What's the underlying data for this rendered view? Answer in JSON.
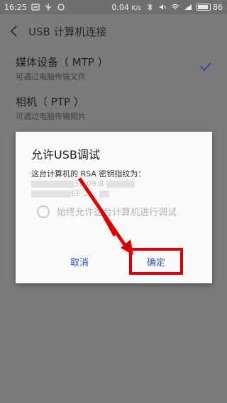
{
  "status_bar": {
    "time": "16:25",
    "net_speed": "0.04",
    "net_speed_unit": "K/s",
    "battery_level": "86"
  },
  "app_bar": {
    "title": "USB 计算机连接"
  },
  "options": [
    {
      "title": "媒体设备（ MTP ）",
      "subtitle": "可通过电脑传输文件",
      "selected": true
    },
    {
      "title": "相机（ PTP ）",
      "subtitle": "可通过电脑传输照片",
      "selected": false
    }
  ],
  "dialog": {
    "title": "允许USB调试",
    "message_line1": "这台计算机的 RSA 密钥指纹为：",
    "fingerprint_visible_1": "37:09:8",
    "fingerprint_visible_2": "EE:2C:",
    "always_allow_label": "始终允许这台计算机进行调试",
    "cancel_label": "取消",
    "ok_label": "确定"
  },
  "colors": {
    "accent_blue": "#2b56d3",
    "highlight_red": "#e10000",
    "scrim": "#7b7b7b"
  }
}
